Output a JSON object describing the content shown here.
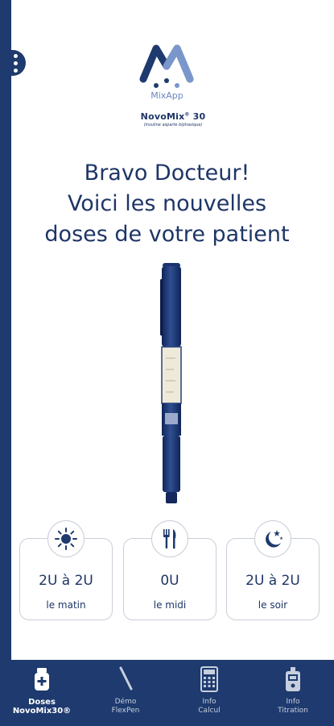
{
  "app": {
    "name": "MixApp"
  },
  "product": {
    "name": "NovoMix",
    "strength": "30",
    "subtitle": "(insuline asparte biphasique)"
  },
  "headline": {
    "line1": "Bravo Docteur!",
    "line2": "Voici les nouvelles",
    "line3": "doses de votre patient"
  },
  "doses": [
    {
      "icon": "sun-icon",
      "value": "2U à 2U",
      "label": "le matin"
    },
    {
      "icon": "fork-knife-icon",
      "value": "0U",
      "label": "le midi"
    },
    {
      "icon": "moon-stars-icon",
      "value": "2U à 2U",
      "label": "le soir"
    }
  ],
  "nav": [
    {
      "line1": "Doses",
      "line2": "NovoMix30®",
      "icon": "vial-icon",
      "active": true
    },
    {
      "line1": "Démo",
      "line2": "FlexPen",
      "icon": "pen-icon",
      "active": false
    },
    {
      "line1": "Info",
      "line2": "Calcul",
      "icon": "calculator-icon",
      "active": false
    },
    {
      "line1": "Info",
      "line2": "Titration",
      "icon": "glucometer-icon",
      "active": false
    }
  ],
  "colors": {
    "primary": "#1e3a6e",
    "logo_light": "#7a97cc",
    "card_border": "#c9ced8"
  }
}
